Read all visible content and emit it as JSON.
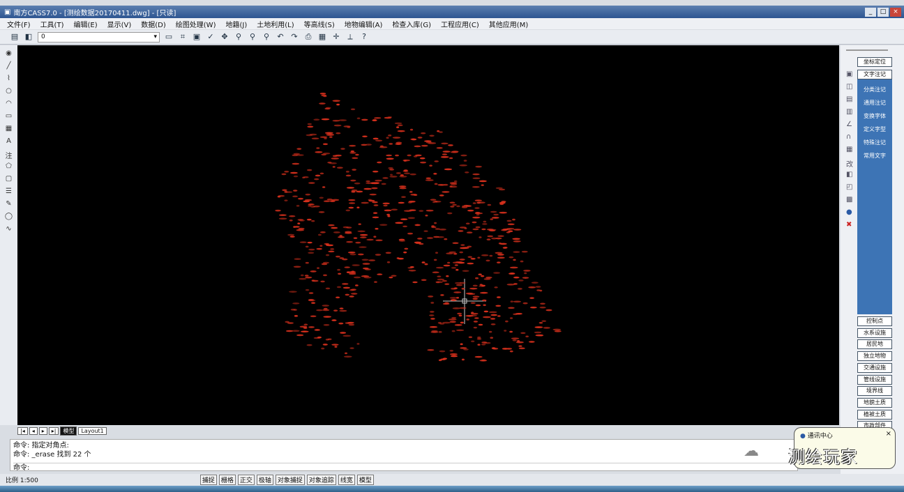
{
  "title": "南方CASS7.0 - [测绘数据20170411.dwg] - [只读]",
  "menu": [
    "文件(F)",
    "工具(T)",
    "编辑(E)",
    "显示(V)",
    "数据(D)",
    "绘图处理(W)",
    "地籍(J)",
    "土地利用(L)",
    "等高线(S)",
    "地物编辑(A)",
    "检查入库(G)",
    "工程应用(C)",
    "其他应用(M)"
  ],
  "layer": "0",
  "right_panel": {
    "top_button": "坐标定位",
    "active": "文字注记",
    "sub_items": [
      "分类注记",
      "通用注记",
      "变换字体",
      "定义字型",
      "特殊注记",
      "常用文字"
    ],
    "items": [
      "控制点",
      "水系设施",
      "居民地",
      "独立地物",
      "交通设施",
      "管线设施",
      "境界线",
      "地貌土质",
      "植被土质",
      "市政部件"
    ]
  },
  "layout_tabs": [
    "模型",
    "Layout1"
  ],
  "command_lines": [
    "命令: 指定对角点:",
    "命令: _erase 找到 22 个",
    "命令:"
  ],
  "status": {
    "scale": "比例 1:500",
    "toggles": [
      "捕捉",
      "栅格",
      "正交",
      "极轴",
      "对象捕捉",
      "对象追踪",
      "线宽",
      "模型"
    ]
  },
  "balloon": {
    "title": "通讯中心",
    "close": "×"
  },
  "watermark": "测绘玩家",
  "colors": {
    "points": "#d8301c",
    "canvas": "#000000",
    "panel": "#3d74b5"
  }
}
